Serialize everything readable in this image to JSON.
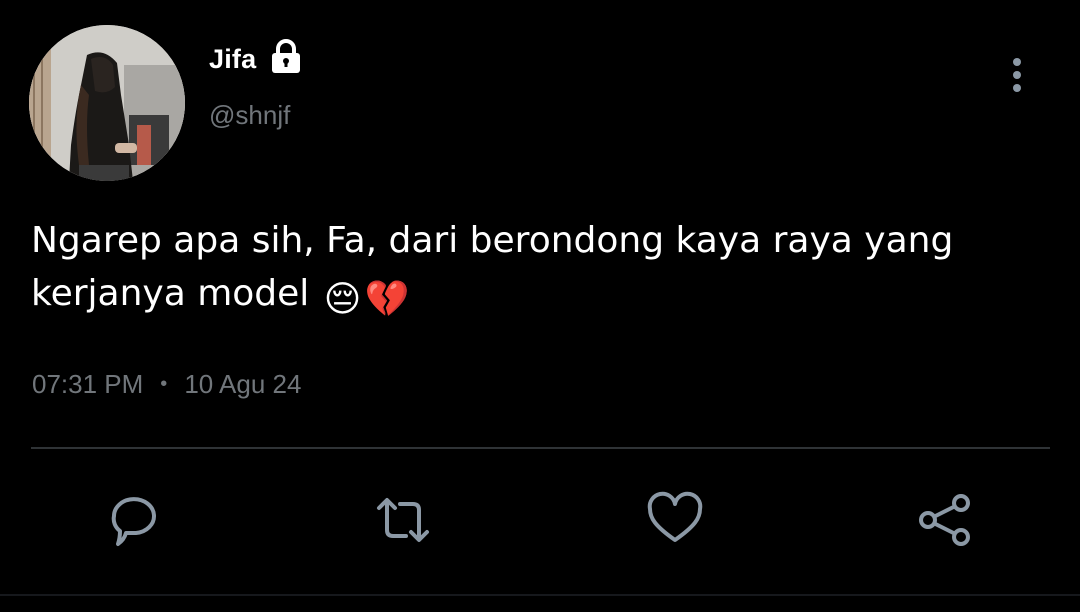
{
  "tweet": {
    "display_name": "Jifa",
    "handle": "@shnjf",
    "locked_icon": "lock-icon",
    "text": "Ngarep apa sih, Fa, dari berondong kaya raya yang kerjanya model",
    "emojis": [
      "😔",
      "💔"
    ],
    "time": "07:31 PM",
    "separator": "•",
    "date": "10 Agu 24"
  },
  "actions": [
    {
      "name": "reply",
      "icon": "comment-icon"
    },
    {
      "name": "retweet",
      "icon": "retweet-icon"
    },
    {
      "name": "like",
      "icon": "heart-icon"
    },
    {
      "name": "share",
      "icon": "share-icon"
    }
  ],
  "colors": {
    "background": "#000000",
    "text_primary": "#ffffff",
    "text_secondary": "#71767b",
    "icon": "#8b98a5",
    "divider": "#2f3336"
  }
}
